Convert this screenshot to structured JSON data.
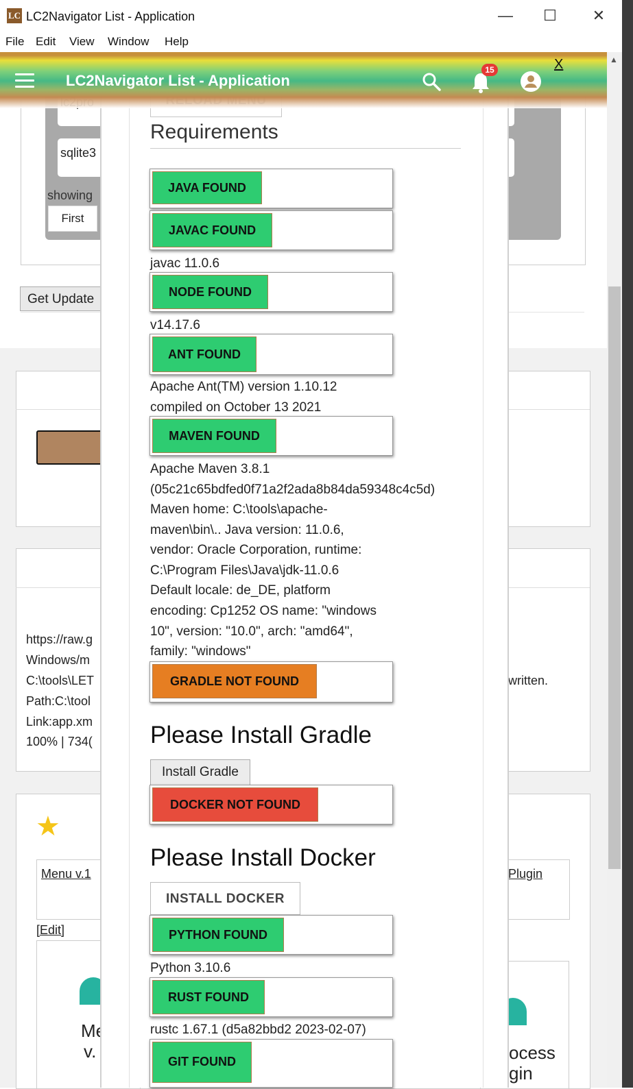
{
  "window": {
    "logo_text": "LC",
    "title": "LC2Navigator List - Application",
    "minimize": "—",
    "maximize": "☐",
    "close": "✕"
  },
  "menubar": [
    "File",
    "Edit",
    "View",
    "Window",
    "Help"
  ],
  "header": {
    "title": "LC2Navigator List - Application",
    "notification_count": "15",
    "close_label": "X",
    "icons": [
      "menu-icon",
      "search-icon",
      "bell-icon",
      "account-circle-icon"
    ]
  },
  "background": {
    "row_lc2": "lc2pro",
    "row_sqlite": "sqlite3",
    "showing": "showing",
    "first": "First",
    "get_update": "Get Update",
    "url_lines": [
      "https://raw.g",
      "Windows/m",
      "C:\\tools\\LET",
      "Path:C:\\tool",
      "Link:app.xm",
      "100% | 734("
    ],
    "written": "written.",
    "menu_link": "Menu v.1",
    "plugin_link": "Plugin",
    "edit_link": "[Edit]",
    "card_left_lines": [
      "Me",
      "v."
    ],
    "card_right_lines": [
      "ocess",
      "gin"
    ]
  },
  "modal": {
    "reload_menu": "RELOAD MENU",
    "requirements_heading": "Requirements",
    "java": "JAVA FOUND",
    "javac": "JAVAC FOUND",
    "javac_version": "javac 11.0.6",
    "node": "NODE FOUND",
    "node_version": "v14.17.6",
    "ant": "ANT FOUND",
    "ant_version": [
      "Apache Ant(TM) version 1.10.12",
      "compiled on October 13 2021"
    ],
    "maven": "MAVEN FOUND",
    "maven_version": [
      "Apache Maven 3.8.1",
      "(05c21c65bdfed0f71a2f2ada8b84da59348c4c5d)",
      "Maven home: C:\\tools\\apache-",
      "maven\\bin\\.. Java version: 11.0.6,",
      "vendor: Oracle Corporation, runtime:",
      "C:\\Program Files\\Java\\jdk-11.0.6",
      "Default locale: de_DE, platform",
      "encoding: Cp1252 OS name: \"windows",
      "10\", version: \"10.0\", arch: \"amd64\",",
      "family: \"windows\""
    ],
    "gradle": "GRADLE NOT FOUND",
    "gradle_heading": "Please Install Gradle",
    "install_gradle": "Install Gradle",
    "docker": "DOCKER NOT FOUND",
    "docker_heading": "Please Install Docker",
    "install_docker": "INSTALL DOCKER",
    "python": "PYTHON FOUND",
    "python_version": "Python 3.10.6",
    "rust": "RUST FOUND",
    "rust_version": "rustc 1.67.1 (d5a82bbd2 2023-02-07)",
    "git": "GIT FOUND"
  },
  "colors": {
    "found": "#2ecc71",
    "not_found_warning": "#e67e22",
    "not_found_error": "#e74c3c",
    "badge": "#e53935",
    "star": "#f5c518"
  }
}
